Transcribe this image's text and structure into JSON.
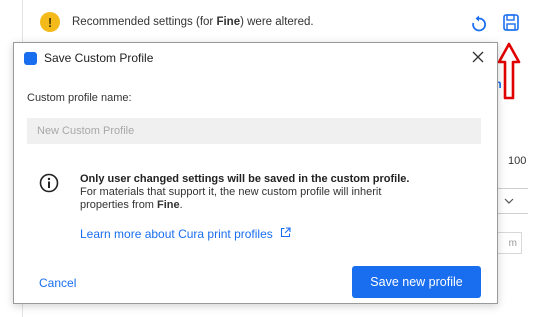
{
  "notice": {
    "prefix": "Recommended settings (for ",
    "profile": "Fine",
    "suffix": ") were altered.",
    "icon": "warning-icon"
  },
  "background": {
    "link_fragment": "m",
    "value": "100",
    "input_fragment": "m"
  },
  "dialog": {
    "title": "Save Custom Profile",
    "field_label": "Custom profile name:",
    "input_value": "",
    "input_placeholder": "New Custom Profile",
    "info_title": "Only user changed settings will be saved in the custom profile.",
    "info_line1": "For materials that support it, the new custom profile will inherit",
    "info_line2_prefix": "properties from ",
    "info_line2_profile": "Fine",
    "info_line2_suffix": ".",
    "learn_more": "Learn more about Cura print profiles",
    "cancel": "Cancel",
    "save": "Save new profile"
  },
  "colors": {
    "accent": "#196ef0",
    "warning": "#f3ba1a",
    "annotation_arrow": "#e00000"
  }
}
